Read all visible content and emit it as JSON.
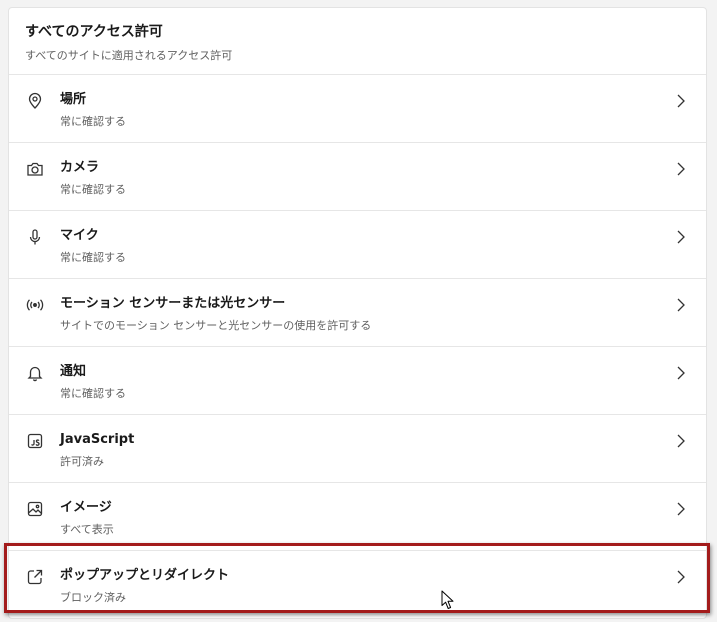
{
  "header": {
    "title": "すべてのアクセス許可",
    "subtitle": "すべてのサイトに適用されるアクセス許可"
  },
  "permissions": [
    {
      "icon": "location-pin-icon",
      "title": "場所",
      "status": "常に確認する"
    },
    {
      "icon": "camera-icon",
      "title": "カメラ",
      "status": "常に確認する"
    },
    {
      "icon": "microphone-icon",
      "title": "マイク",
      "status": "常に確認する"
    },
    {
      "icon": "motion-sensor-icon",
      "title": "モーション センサーまたは光センサー",
      "status": "サイトでのモーション センサーと光センサーの使用を許可する"
    },
    {
      "icon": "bell-icon",
      "title": "通知",
      "status": "常に確認する"
    },
    {
      "icon": "javascript-icon",
      "title": "JavaScript",
      "status": "許可済み"
    },
    {
      "icon": "image-icon",
      "title": "イメージ",
      "status": "すべて表示"
    },
    {
      "icon": "external-link-icon",
      "title": "ポップアップとリダイレクト",
      "status": "ブロック済み"
    }
  ],
  "colors": {
    "highlight_border": "#a31b1b",
    "card_bg": "#ffffff",
    "page_bg": "#f3f3f3"
  }
}
